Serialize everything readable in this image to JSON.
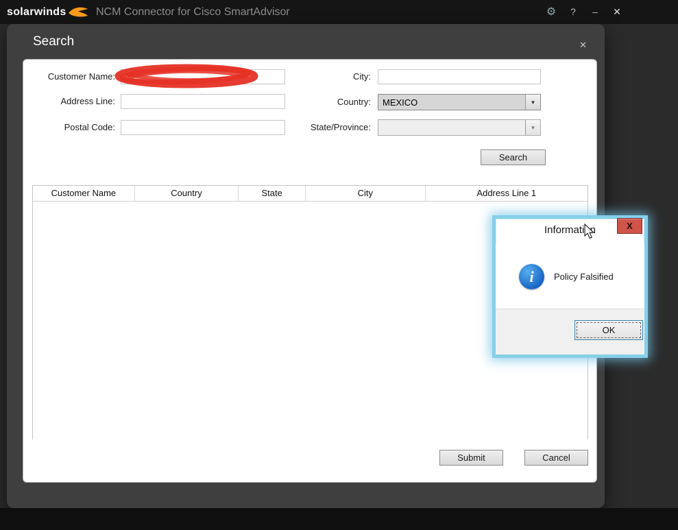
{
  "titlebar": {
    "logo_text": "solarwinds",
    "app_title": "NCM Connector for Cisco SmartAdvisor",
    "icons": {
      "gear": "⚙",
      "help": "?",
      "minimize": "–",
      "close": "✕"
    }
  },
  "search_window": {
    "title": "Search",
    "close_icon": "✕",
    "form": {
      "labels": {
        "customer_name": "Customer Name:",
        "address_line": "Address Line:",
        "postal_code": "Postal Code:",
        "city": "City:",
        "country": "Country:",
        "state": "State/Province:"
      },
      "values": {
        "customer_name": "",
        "address_line": "",
        "postal_code": "",
        "city": "",
        "country": "MEXICO",
        "state": ""
      },
      "dropdown_arrow": "▼",
      "search_button": "Search"
    },
    "results_table": {
      "columns": [
        "Customer Name",
        "Country",
        "State",
        "City",
        "Address Line 1"
      ],
      "rows": []
    },
    "buttons": {
      "submit": "Submit",
      "cancel": "Cancel"
    }
  },
  "info_dialog": {
    "title": "Information",
    "close_label": "X",
    "message": "Policy Falsified",
    "ok_button": "OK"
  },
  "colors": {
    "accent-blue": "#3c7fb1",
    "dialog-border": "#86cfe9",
    "close-red": "#d0544a",
    "swoosh-orange": "#f99d1c"
  }
}
